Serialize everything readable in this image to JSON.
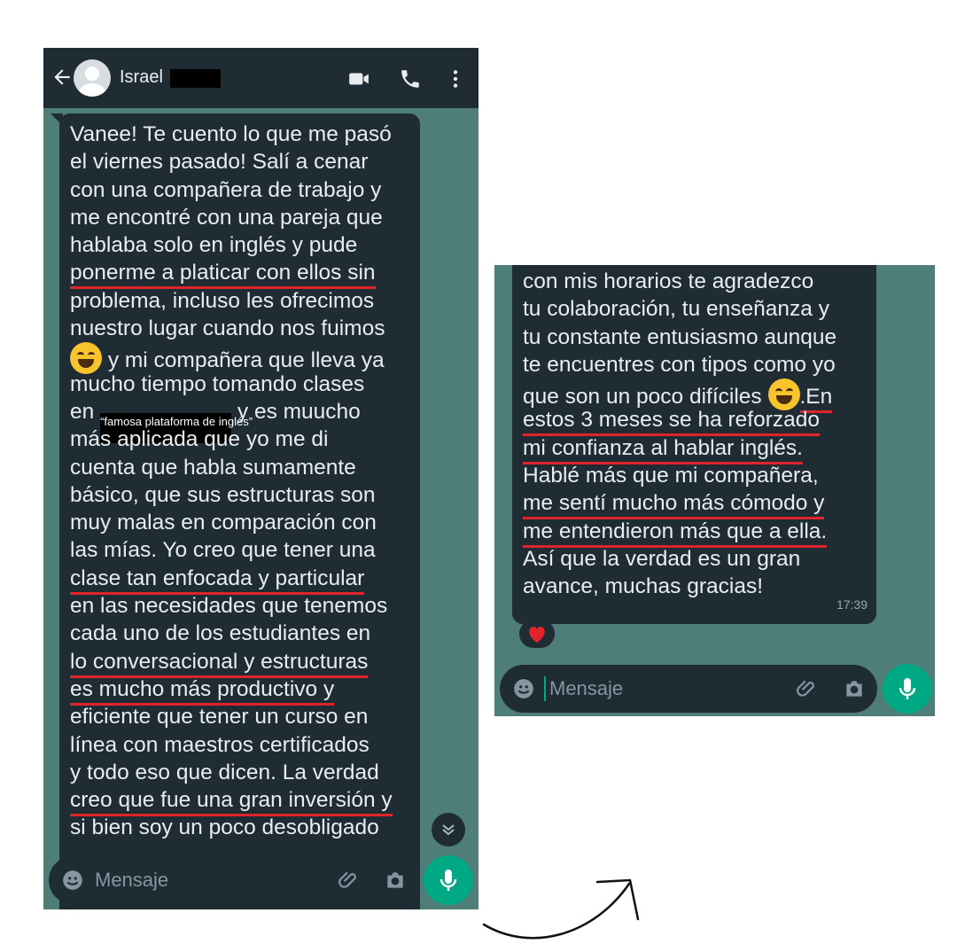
{
  "left_chat": {
    "contact_name": "Israel",
    "message_lines": [
      "Vanee! Te cuento lo que me pasó",
      "el viernes pasado! Salí a cenar",
      "con una compañera de trabajo y",
      "me encontré con una pareja que",
      "hablaba solo en inglés y pude",
      "ponerme a platicar con ellos sin",
      "problema, incluso les ofrecimos",
      "nuestro lugar cuando nos fuimos",
      "y mi compañera que lleva ya",
      "mucho tiempo tomando clases",
      "en",
      "y es muucho",
      "más aplicada que yo me di",
      "cuenta que habla sumamente",
      "básico, que sus estructuras son",
      "muy malas en comparación con",
      "las mías. Yo creo que tener una",
      "clase tan enfocada y particular",
      "en las necesidades que tenemos",
      "cada uno de los estudiantes en",
      "lo conversacional y estructuras",
      "es mucho más productivo y",
      "eficiente que tener un curso en",
      "línea con maestros certificados",
      "y todo eso que dicen. La verdad",
      "creo que fue una gran inversión y",
      "si bien soy un poco desobligado"
    ],
    "censor_label": "“famosa plataforma de inglés”",
    "input_placeholder": "Mensaje"
  },
  "right_chat": {
    "message_lines": [
      "con mis horarios te agradezco",
      "tu colaboración, tu enseñanza y",
      "tu constante entusiasmo aunque",
      "te encuentres con tipos como yo",
      "que son un poco difíciles",
      ".En",
      "estos 3 meses se ha reforzado",
      "mi confianza al hablar inglés.",
      "Hablé más que mi compañera,",
      "me sentí mucho más cómodo y",
      "me entendieron más que a ella.",
      "Así que la verdad es un gran",
      "avance, muchas gracias!"
    ],
    "timestamp": "17:39",
    "input_placeholder": "Mensaje"
  },
  "colors": {
    "chat_bg": "#4f7d78",
    "bubble": "#1f2c34",
    "underline": "#e0242a",
    "mic": "#00a884"
  }
}
